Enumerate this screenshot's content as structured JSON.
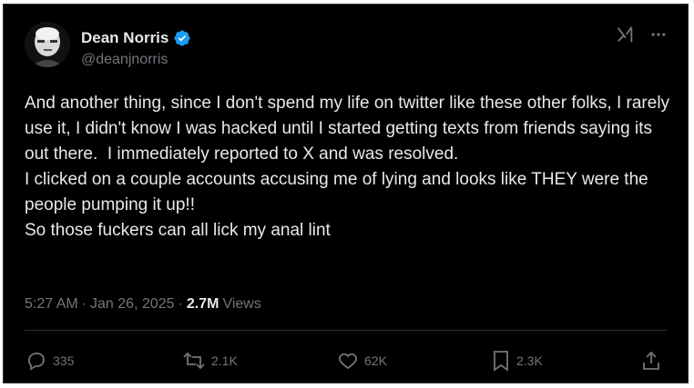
{
  "author": {
    "name": "Dean Norris",
    "handle": "@deanjnorris",
    "verified": true
  },
  "icons": {
    "avatar": "profile-avatar",
    "verified": "verified-badge-icon",
    "grok": "grok-icon",
    "more": "more-icon"
  },
  "post": {
    "text": "And another thing, since I don't spend my life on twitter like these other folks, I rarely use it, I didn't know I was hacked until I started getting texts from friends saying its out there.  I immediately reported to X and was resolved.\nI clicked on a couple accounts accusing me of lying and looks like THEY were the people pumping it up!!\nSo those fuckers can all lick my anal lint",
    "time": "5:27 AM",
    "separator1": "·",
    "date": "Jan 26, 2025",
    "separator2": "·",
    "views_count": "2.7M",
    "views_label": "Views"
  },
  "actions": {
    "replies": "335",
    "reposts": "2.1K",
    "likes": "62K",
    "bookmarks": "2.3K"
  },
  "colors": {
    "background": "#000000",
    "text": "#e7e9ea",
    "muted": "#71767b",
    "verified": "#1d9bf0",
    "border": "#2f3336"
  }
}
